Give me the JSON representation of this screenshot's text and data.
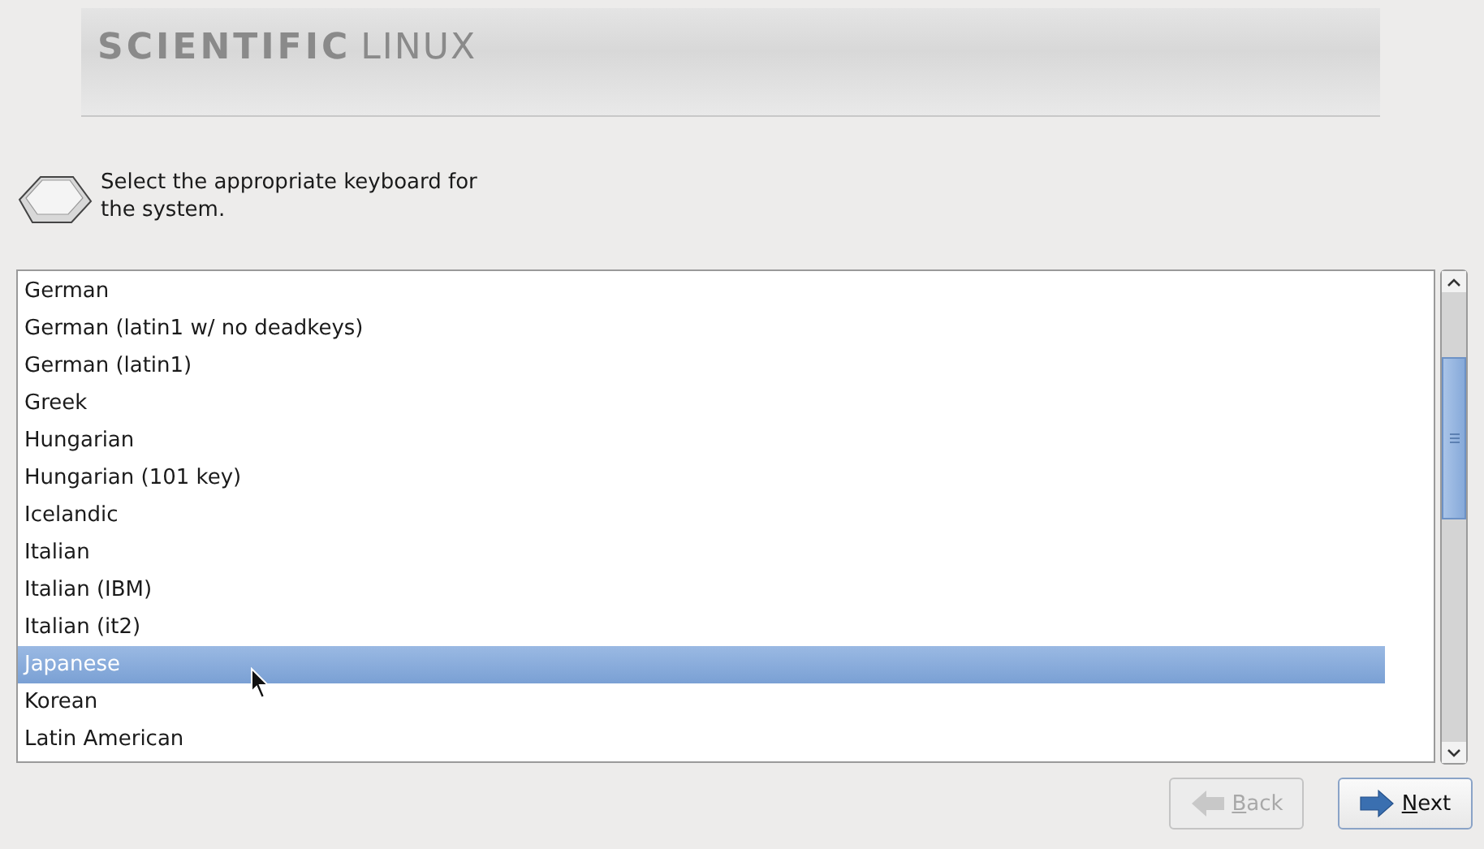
{
  "header": {
    "logo_bold": "SCIENTIFIC",
    "logo_light": "LINUX"
  },
  "prompt": "Select the appropriate keyboard for the system.",
  "keyboards": [
    {
      "label": "German",
      "selected": false
    },
    {
      "label": "German (latin1 w/ no deadkeys)",
      "selected": false
    },
    {
      "label": "German (latin1)",
      "selected": false
    },
    {
      "label": "Greek",
      "selected": false
    },
    {
      "label": "Hungarian",
      "selected": false
    },
    {
      "label": "Hungarian (101 key)",
      "selected": false
    },
    {
      "label": "Icelandic",
      "selected": false
    },
    {
      "label": "Italian",
      "selected": false
    },
    {
      "label": "Italian (IBM)",
      "selected": false
    },
    {
      "label": "Italian (it2)",
      "selected": false
    },
    {
      "label": "Japanese",
      "selected": true
    },
    {
      "label": "Korean",
      "selected": false
    },
    {
      "label": "Latin American",
      "selected": false
    }
  ],
  "buttons": [
    {
      "label": "Back",
      "kind": "back",
      "disabled": true
    },
    {
      "label": "Next",
      "kind": "next",
      "disabled": false
    }
  ]
}
